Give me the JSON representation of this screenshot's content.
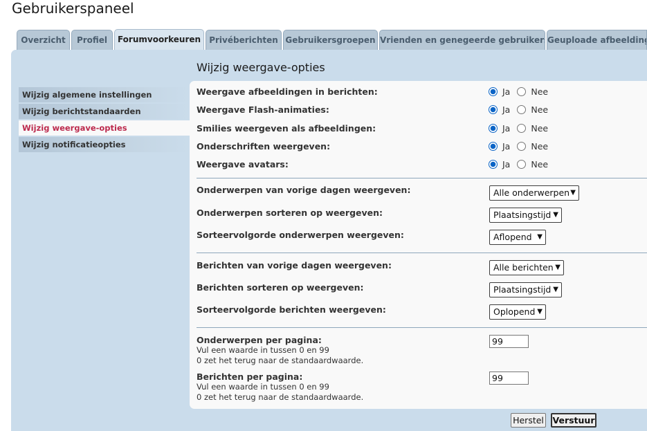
{
  "page": {
    "title": "Gebruikerspaneel"
  },
  "tabs": [
    {
      "label": "Overzicht",
      "active": false
    },
    {
      "label": "Profiel",
      "active": false
    },
    {
      "label": "Forumvoorkeuren",
      "active": true
    },
    {
      "label": "Privéberichten",
      "active": false
    },
    {
      "label": "Gebruikersgroepen",
      "active": false
    },
    {
      "label": "Vrienden en genegeerde gebruikers",
      "active": false
    },
    {
      "label": "Geuploade afbeeldingen",
      "active": false
    }
  ],
  "sidebar": {
    "items": [
      {
        "label": "Wijzig algemene instellingen",
        "active": false
      },
      {
        "label": "Wijzig berichtstandaarden",
        "active": false
      },
      {
        "label": "Wijzig weergave-opties",
        "active": true
      },
      {
        "label": "Wijzig notificatieopties",
        "active": false
      }
    ]
  },
  "main": {
    "heading": "Wijzig weergave-opties",
    "radio_yes": "Ja",
    "radio_no": "Nee",
    "radio_options": [
      {
        "label": "Weergave afbeeldingen in berichten:",
        "selected": "Ja"
      },
      {
        "label": "Weergave Flash-animaties:",
        "selected": "Ja"
      },
      {
        "label": "Smilies weergeven als afbeeldingen:",
        "selected": "Ja"
      },
      {
        "label": "Onderschriften weergeven:",
        "selected": "Ja"
      },
      {
        "label": "Weergave avatars:",
        "selected": "Ja"
      }
    ],
    "topic_options": [
      {
        "label": "Onderwerpen van vorige dagen weergeven:",
        "value": "Alle onderwerpen"
      },
      {
        "label": "Onderwerpen sorteren op weergeven:",
        "value": "Plaatsingstijd"
      },
      {
        "label": "Sorteervolgorde onderwerpen weergeven:",
        "value": "Aflopend"
      }
    ],
    "post_options": [
      {
        "label": "Berichten van vorige dagen weergeven:",
        "value": "Alle berichten"
      },
      {
        "label": "Berichten sorteren op weergeven:",
        "value": "Plaatsingstijd"
      },
      {
        "label": "Sorteervolgorde berichten weergeven:",
        "value": "Oplopend"
      }
    ],
    "per_page": [
      {
        "label": "Onderwerpen per pagina:",
        "explain1": "Vul een waarde in tussen 0 en 99",
        "explain2": "0 zet het terug naar de standaardwaarde.",
        "value": "99"
      },
      {
        "label": "Berichten per pagina:",
        "explain1": "Vul een waarde in tussen 0 en 99",
        "explain2": "0 zet het terug naar de standaardwaarde.",
        "value": "99"
      }
    ]
  },
  "buttons": {
    "reset": "Herstel",
    "submit": "Verstuur"
  },
  "colors": {
    "panel": "#cadceb",
    "tab": "#b7c8d6",
    "active_menu_text": "#bc2a4d",
    "radio_checked": "#0b64c6"
  }
}
